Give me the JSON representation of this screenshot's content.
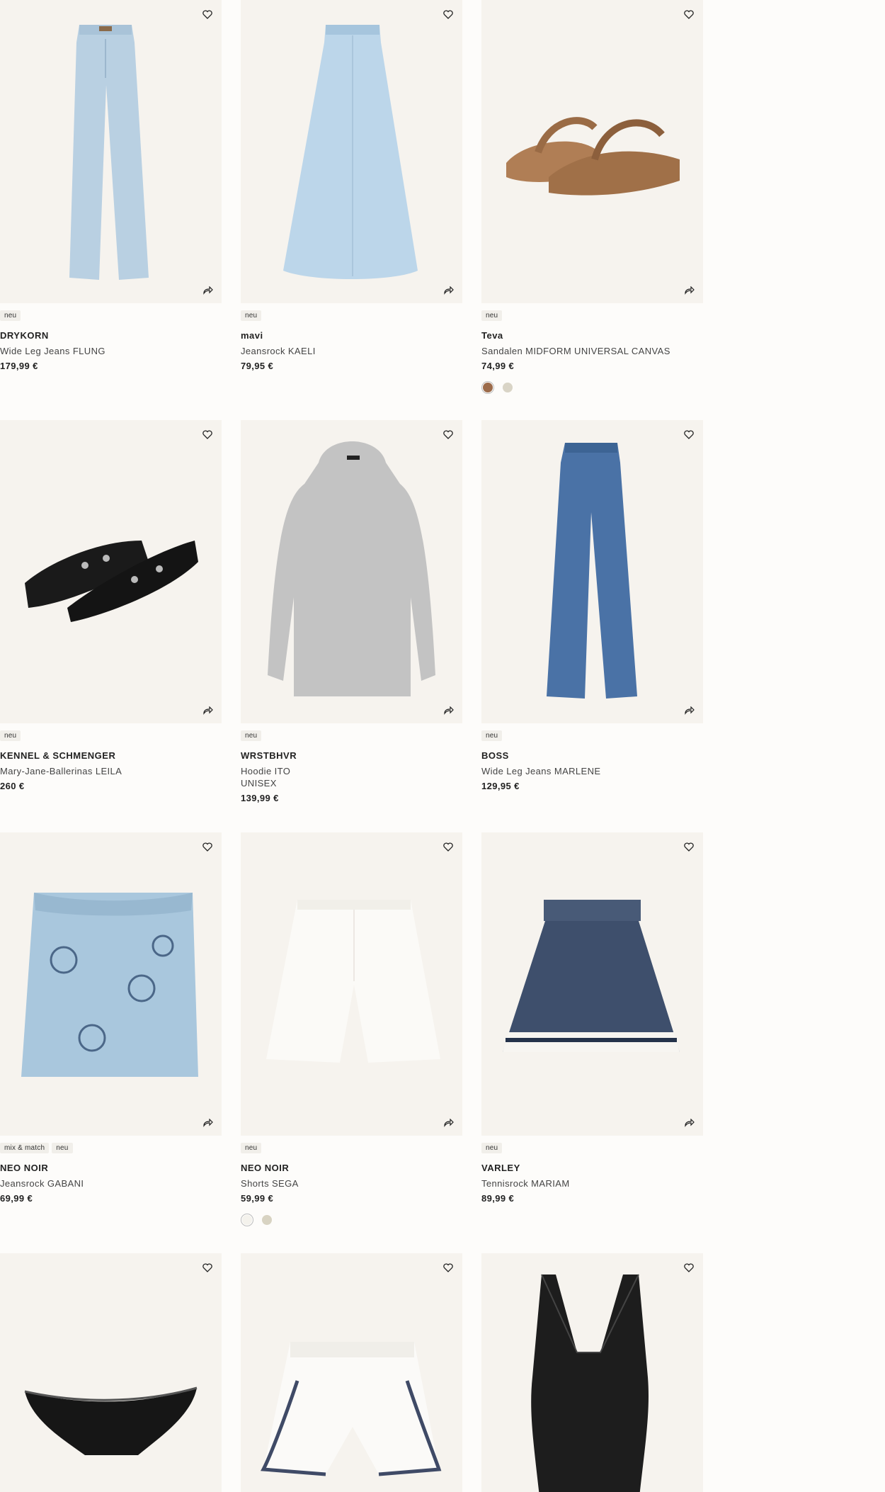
{
  "products": [
    {
      "badges": [
        "neu"
      ],
      "brand": "DRYKORN",
      "name": "Wide Leg Jeans FLUNG",
      "price": "179,99 €",
      "swatches": [],
      "image": "wide-leg-jeans-light-blue"
    },
    {
      "badges": [
        "neu"
      ],
      "brand": "mavi",
      "name": "Jeansrock KAELI",
      "price": "79,95 €",
      "swatches": [],
      "image": "denim-maxi-skirt"
    },
    {
      "badges": [
        "neu"
      ],
      "brand": "Teva",
      "name": "Sandalen MIDFORM UNIVERSAL CANVAS",
      "price": "74,99 €",
      "swatches": [
        "#9c6b4a",
        "#d9d4c6"
      ],
      "image": "brown-sport-sandals"
    },
    {
      "badges": [
        "neu"
      ],
      "brand": "KENNEL & SCHMENGER",
      "name": "Mary-Jane-Ballerinas LEILA",
      "price": "260 €",
      "swatches": [],
      "image": "black-buckle-ballerinas"
    },
    {
      "badges": [
        "neu"
      ],
      "brand": "WRSTBHVR",
      "name": "Hoodie ITO",
      "name2": "UNISEX",
      "price": "139,99 €",
      "swatches": [],
      "image": "grey-hoodie"
    },
    {
      "badges": [
        "neu"
      ],
      "brand": "BOSS",
      "name": "Wide Leg Jeans MARLENE",
      "price": "129,95 €",
      "swatches": [],
      "image": "wide-leg-jeans-mid-blue"
    },
    {
      "badges": [
        "mix & match",
        "neu"
      ],
      "brand": "NEO NOIR",
      "name": "Jeansrock GABANI",
      "price": "69,99 €",
      "swatches": [],
      "image": "paisley-denim-mini-skirt"
    },
    {
      "badges": [
        "neu"
      ],
      "brand": "NEO NOIR",
      "name": "Shorts SEGA",
      "price": "59,99 €",
      "swatches": [
        "#f4f2ec",
        "#d8d3c2"
      ],
      "image": "white-shorts"
    },
    {
      "badges": [
        "neu"
      ],
      "brand": "VARLEY",
      "name": "Tennisrock MARIAM",
      "price": "89,99 €",
      "swatches": [],
      "image": "navy-pleated-tennis-skirt"
    },
    {
      "badges": [],
      "brand": "",
      "name": "",
      "price": "",
      "swatches": [],
      "image": "black-lace-briefs"
    },
    {
      "badges": [],
      "brand": "",
      "name": "",
      "price": "",
      "swatches": [],
      "image": "white-sport-shorts"
    },
    {
      "badges": [],
      "brand": "",
      "name": "",
      "price": "",
      "swatches": [],
      "image": "black-lace-bodysuit"
    }
  ],
  "icons": {
    "wishlist": "heart-icon",
    "share": "share-icon"
  },
  "colors": {
    "image_bg": "#f6f3ee",
    "text": "#262626",
    "badge_bg": "#f1efea"
  }
}
